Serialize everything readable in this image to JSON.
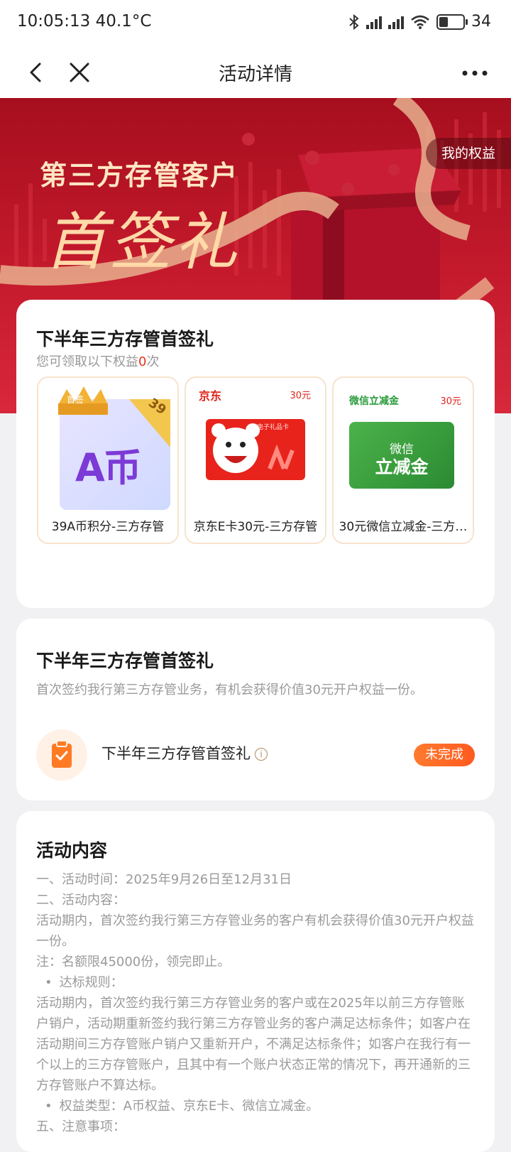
{
  "status_bar": {
    "time": "10:05:13 40.1°C",
    "battery": "34"
  },
  "nav": {
    "title": "活动详情"
  },
  "banner": {
    "line1": "第三方存管客户",
    "line2": "首签礼",
    "my_rights": "我的权益"
  },
  "rewards": {
    "title": "下半年三方存管首签礼",
    "sub_prefix": "您可领取以下权益",
    "count": "0",
    "sub_suffix": "次",
    "items": [
      {
        "label": "39A币积分-三方存管",
        "tag": "首签",
        "amount": "39",
        "art_text": "A币"
      },
      {
        "label": "京东E卡30元-三方存管",
        "brand": "京东",
        "price": "30元",
        "card_text": "电子礼品卡"
      },
      {
        "label": "30元微信立减金-三方…",
        "brand": "微信立减金",
        "price": "30元",
        "card_line1": "微信",
        "card_line2": "立减金"
      }
    ]
  },
  "task": {
    "title": "下半年三方存管首签礼",
    "desc": "首次签约我行第三方存管业务，有机会获得价值30元开户权益一份。",
    "name": "下半年三方存管首签礼",
    "status": "未完成"
  },
  "content": {
    "title": "活动内容",
    "lines": [
      {
        "text": "一、活动时间：2025年9月26日至12月31日",
        "bullet": false
      },
      {
        "text": "二、活动内容：",
        "bullet": false
      },
      {
        "text": "活动期内，首次签约我行第三方存管业务的客户有机会获得价值30元开户权益一份。",
        "bullet": false
      },
      {
        "text": "注：名额限45000份，领完即止。",
        "bullet": false
      },
      {
        "text": "达标规则：",
        "bullet": true
      },
      {
        "text": "活动期内，首次签约我行第三方存管业务的客户或在2025年以前三方存管账户销户，活动期重新签约我行第三方存管业务的客户满足达标条件；如客户在活动期间三方存管账户销户又重新开户，不满足达标条件；如客户在我行有一个以上的三方存管账户，且其中有一个账户状态正常的情况下，再开通新的三方存管账户不算达标。",
        "bullet": false
      },
      {
        "text": "权益类型：A币权益、京东E卡、微信立减金。",
        "bullet": true
      },
      {
        "text": "五、注意事项：",
        "bullet": false
      }
    ]
  }
}
